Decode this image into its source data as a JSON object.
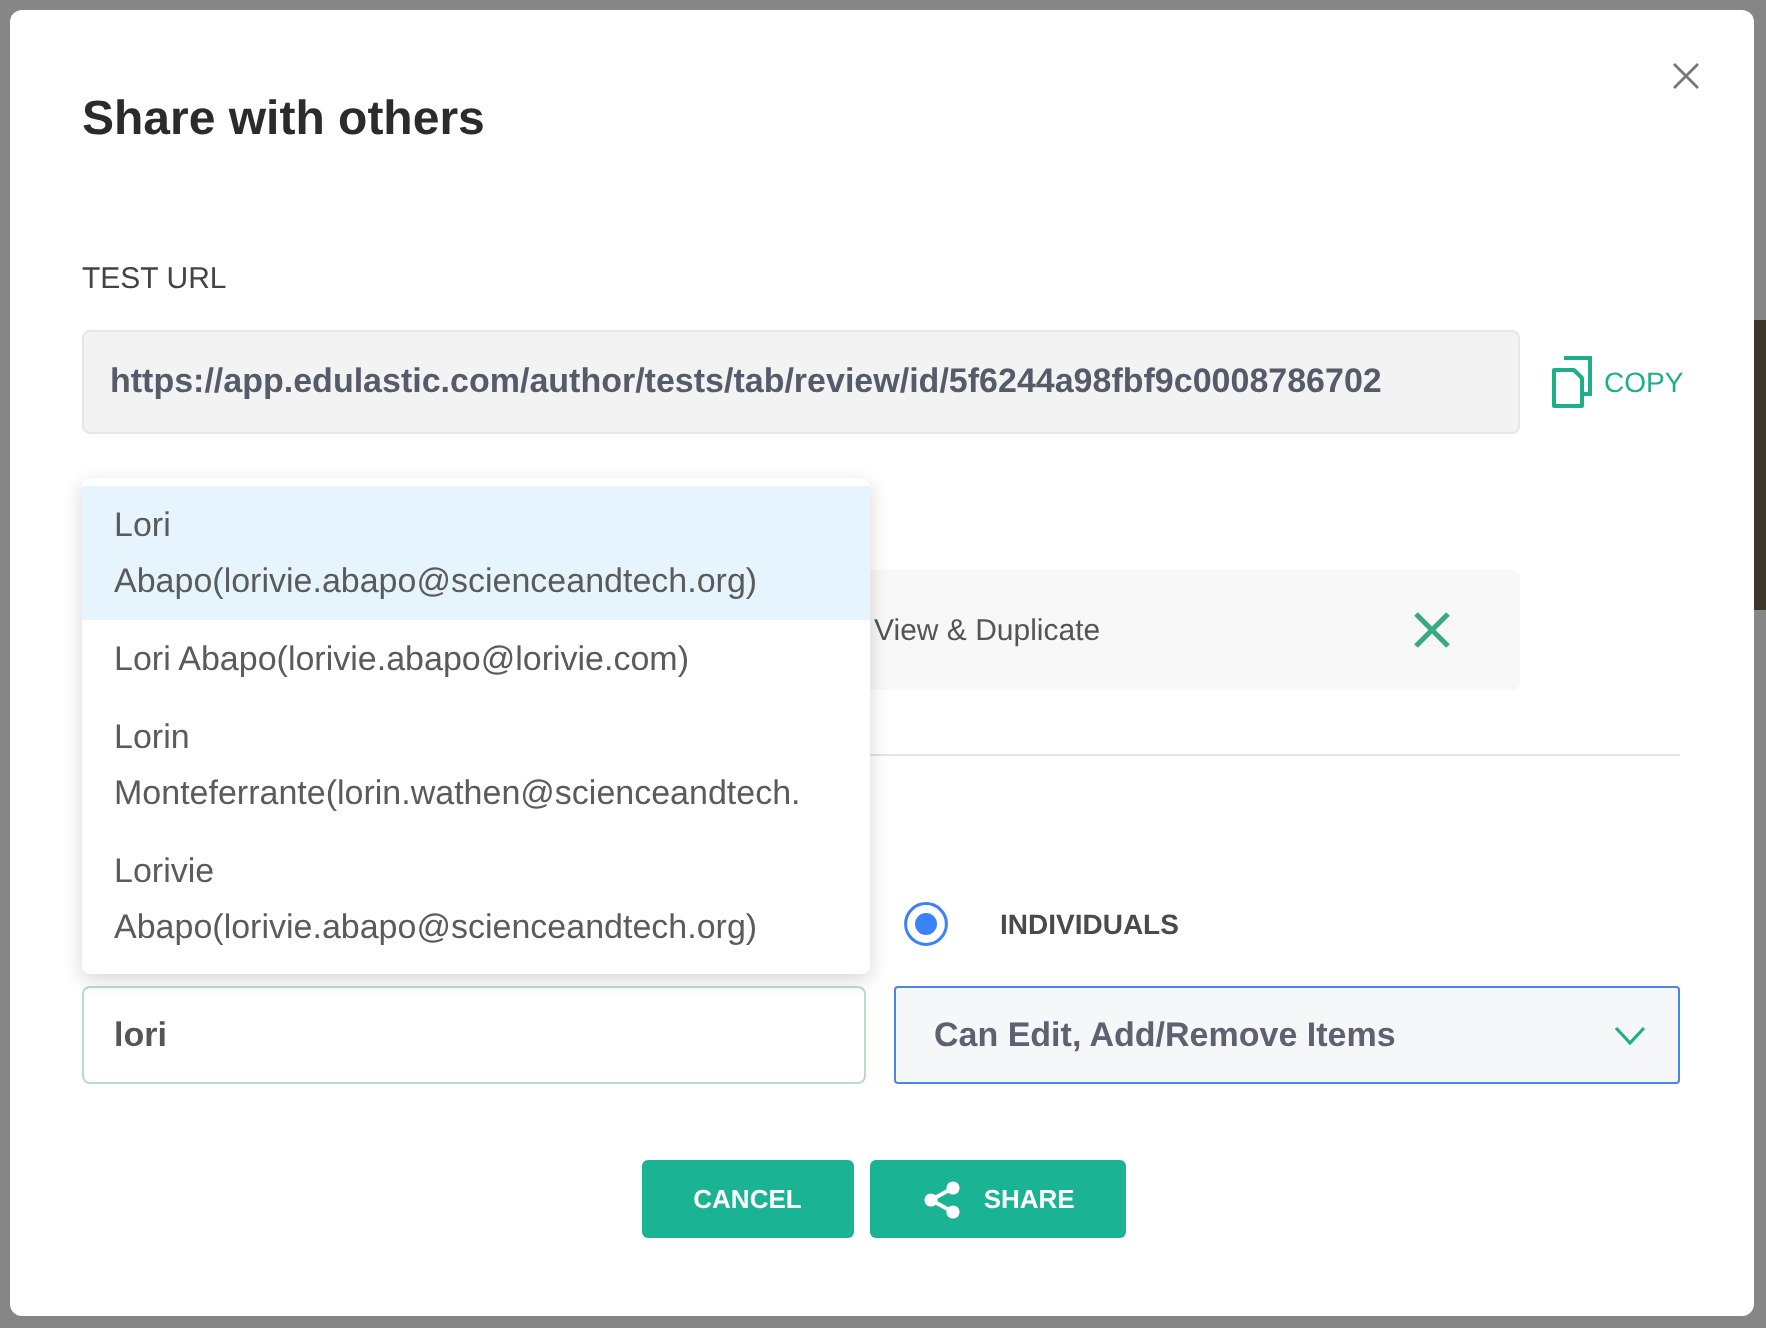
{
  "dialog": {
    "title": "Share with others"
  },
  "test_url": {
    "label": "TEST URL",
    "value": "https://app.edulastic.com/author/tests/tab/review/id/5f6244a98fbf9c0008786702",
    "action": "COPY"
  },
  "shared_entry": {
    "permission": "View & Duplicate"
  },
  "share_type": {
    "options": [
      {
        "label": "INDIVIDUALS",
        "selected": true
      }
    ]
  },
  "user_search": {
    "value": "lori",
    "suggestions": [
      {
        "label": "Lori Abapo(lorivie.abapo@scienceandtech.org)",
        "selected": true
      },
      {
        "label": "Lori Abapo(lorivie.abapo@lorivie.com)",
        "selected": false
      },
      {
        "label": "Lorin Monteferrante(lorin.wathen@scienceandtech.",
        "selected": false
      },
      {
        "label": "Lorivie Abapo(lorivie.abapo@scienceandtech.org)",
        "selected": false
      }
    ]
  },
  "permission_select": {
    "value": "Can Edit, Add/Remove Items"
  },
  "buttons": [
    {
      "kind": "cancel",
      "label": "CANCEL"
    },
    {
      "kind": "share",
      "label": "SHARE"
    }
  ]
}
